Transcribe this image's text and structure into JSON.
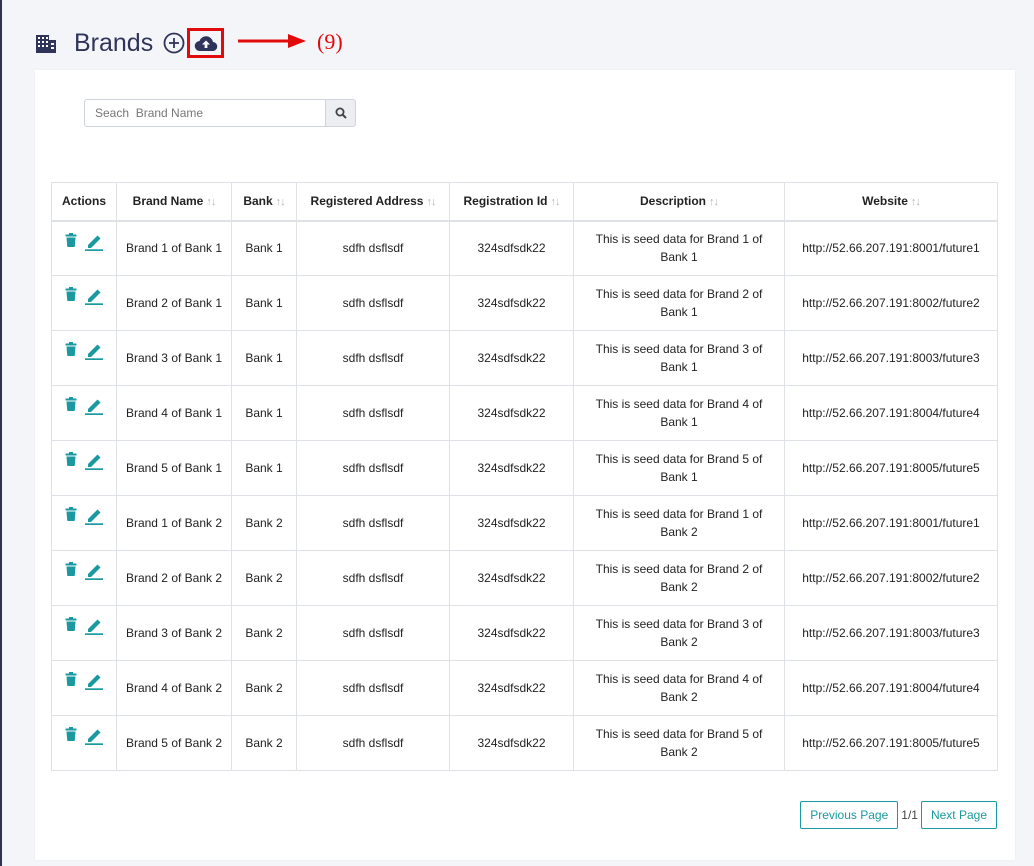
{
  "header": {
    "title": "Brands"
  },
  "annotation": {
    "label": "(9)"
  },
  "search": {
    "placeholder": "Seach  Brand Name"
  },
  "table": {
    "columns": [
      {
        "label": "Actions",
        "sortable": false
      },
      {
        "label": "Brand Name",
        "sortable": true
      },
      {
        "label": "Bank",
        "sortable": true
      },
      {
        "label": "Registered Address",
        "sortable": true
      },
      {
        "label": "Registration Id",
        "sortable": true
      },
      {
        "label": "Description",
        "sortable": true
      },
      {
        "label": "Website",
        "sortable": true
      }
    ],
    "rows": [
      {
        "brand": "Brand 1 of Bank 1",
        "bank": "Bank 1",
        "address": "sdfh dsflsdf",
        "reg_id": "324sdfsdk22",
        "description": "This is seed data for Brand 1 of Bank 1",
        "website": "http://52.66.207.191:8001/future1"
      },
      {
        "brand": "Brand 2 of Bank 1",
        "bank": "Bank 1",
        "address": "sdfh dsflsdf",
        "reg_id": "324sdfsdk22",
        "description": "This is seed data for Brand 2 of Bank 1",
        "website": "http://52.66.207.191:8002/future2"
      },
      {
        "brand": "Brand 3 of Bank 1",
        "bank": "Bank 1",
        "address": "sdfh dsflsdf",
        "reg_id": "324sdfsdk22",
        "description": "This is seed data for Brand 3 of Bank 1",
        "website": "http://52.66.207.191:8003/future3"
      },
      {
        "brand": "Brand 4 of Bank 1",
        "bank": "Bank 1",
        "address": "sdfh dsflsdf",
        "reg_id": "324sdfsdk22",
        "description": "This is seed data for Brand 4 of Bank 1",
        "website": "http://52.66.207.191:8004/future4"
      },
      {
        "brand": "Brand 5 of Bank 1",
        "bank": "Bank 1",
        "address": "sdfh dsflsdf",
        "reg_id": "324sdfsdk22",
        "description": "This is seed data for Brand 5 of Bank 1",
        "website": "http://52.66.207.191:8005/future5"
      },
      {
        "brand": "Brand 1 of Bank 2",
        "bank": "Bank 2",
        "address": "sdfh dsflsdf",
        "reg_id": "324sdfsdk22",
        "description": "This is seed data for Brand 1 of Bank 2",
        "website": "http://52.66.207.191:8001/future1"
      },
      {
        "brand": "Brand 2 of Bank 2",
        "bank": "Bank 2",
        "address": "sdfh dsflsdf",
        "reg_id": "324sdfsdk22",
        "description": "This is seed data for Brand 2 of Bank 2",
        "website": "http://52.66.207.191:8002/future2"
      },
      {
        "brand": "Brand 3 of Bank 2",
        "bank": "Bank 2",
        "address": "sdfh dsflsdf",
        "reg_id": "324sdfsdk22",
        "description": "This is seed data for Brand 3 of Bank 2",
        "website": "http://52.66.207.191:8003/future3"
      },
      {
        "brand": "Brand 4 of Bank 2",
        "bank": "Bank 2",
        "address": "sdfh dsflsdf",
        "reg_id": "324sdfsdk22",
        "description": "This is seed data for Brand 4 of Bank 2",
        "website": "http://52.66.207.191:8004/future4"
      },
      {
        "brand": "Brand 5 of Bank 2",
        "bank": "Bank 2",
        "address": "sdfh dsflsdf",
        "reg_id": "324sdfsdk22",
        "description": "This is seed data for Brand 5 of Bank 2",
        "website": "http://52.66.207.191:8005/future5"
      }
    ]
  },
  "pagination": {
    "prev_label": "Previous Page",
    "page_info": "1/1",
    "next_label": "Next Page"
  },
  "icons": {
    "title": "building-icon",
    "add": "plus-circle-icon",
    "upload": "cloud-upload-icon",
    "search": "search-icon",
    "delete": "trash-icon",
    "edit": "pencil-icon"
  },
  "colors": {
    "title": "#30345a",
    "accent": "#1a9aa0",
    "annotation": "#e10b0b"
  }
}
